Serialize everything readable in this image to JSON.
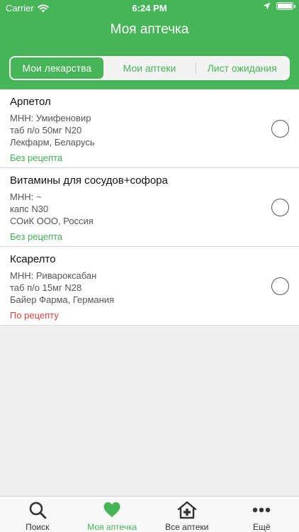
{
  "status": {
    "carrier": "Carrier",
    "time": "6:24 PM",
    "battery_level": 1.0
  },
  "header": {
    "title": "Моя аптечка"
  },
  "segments": [
    {
      "label": "Мои лекарства",
      "active": true
    },
    {
      "label": "Мои аптеки",
      "active": false
    },
    {
      "label": "Лист ожидания",
      "active": false
    }
  ],
  "items": [
    {
      "name": "Арпетол",
      "mnn": "МНН: Умифеновир",
      "form": "таб п/о 50мг N20",
      "maker": "Лекфарм, Беларусь",
      "rx": "Без рецепта"
    },
    {
      "name": "Витамины для сосудов+софора",
      "mnn": "МНН: ~",
      "form": "капс N30",
      "maker": "СОиК ООО, Россия",
      "rx": "Без рецепта"
    },
    {
      "name": "Ксарелто",
      "mnn": "МНН: Ривароксабан",
      "form": "таб п/о 15мг N28",
      "maker": "Байер Фарма, Германия",
      "rx": "По рецепту"
    }
  ],
  "tabbar": [
    {
      "label": "Поиск",
      "icon": "search-icon",
      "active": false
    },
    {
      "label": "Моя аптечка",
      "icon": "heart-icon",
      "active": true
    },
    {
      "label": "Все аптеки",
      "icon": "pharmacy-house-icon",
      "active": false
    },
    {
      "label": "Ещё",
      "icon": "more-dots-icon",
      "active": false
    }
  ],
  "colors": {
    "brand": "#45b557",
    "rx_free": "#3fb04f",
    "rx_need": "#e0413a"
  }
}
